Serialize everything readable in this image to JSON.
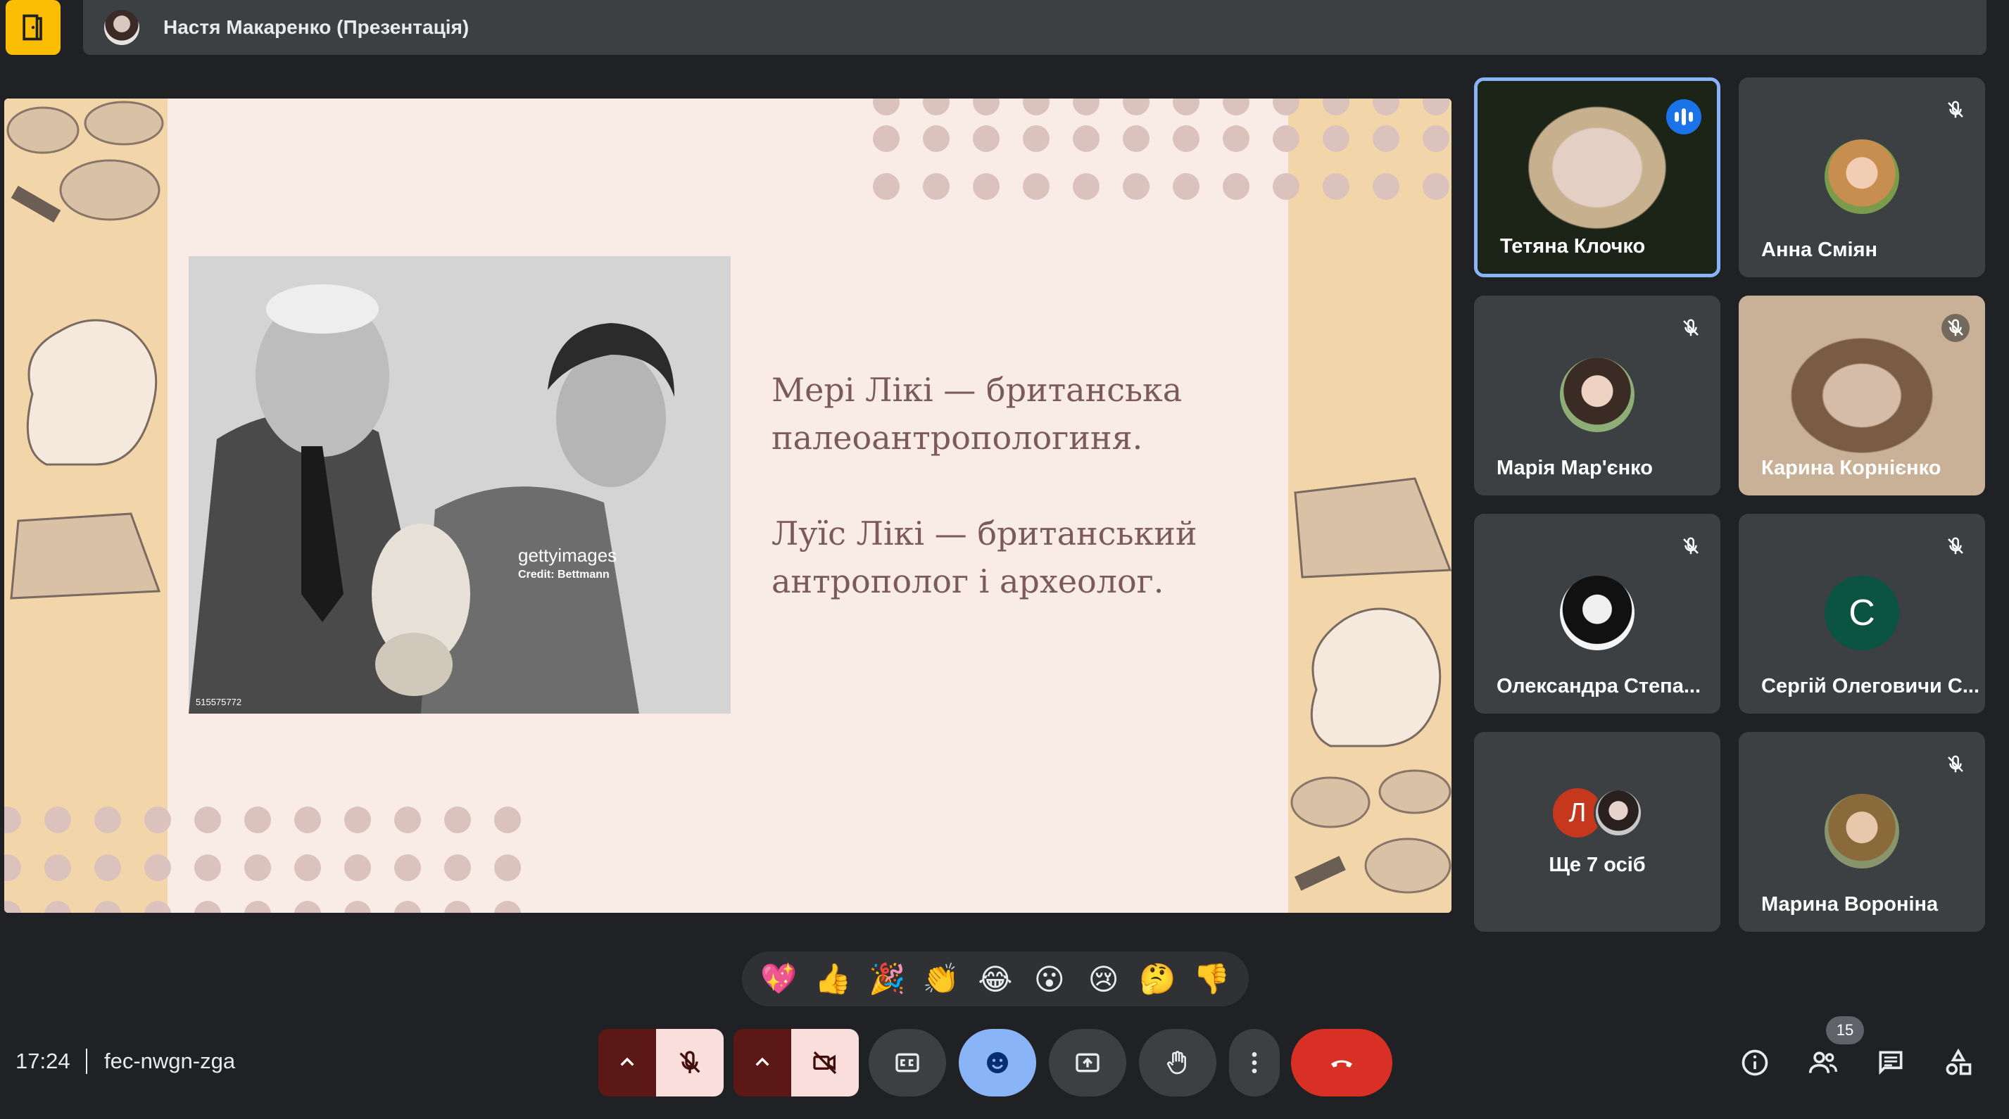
{
  "presenter": {
    "name": "Настя Макаренко (Презентація)"
  },
  "slide": {
    "photo_watermark": "gettyimages",
    "photo_credit": "Credit: Bettmann",
    "photo_id": "515575772",
    "paragraphs": [
      "Мері Лікі — британська палеоантропологиня.",
      "Луїс Лікі — британський антрополог і археолог."
    ]
  },
  "participants": [
    {
      "name": "Тетяна Клочко",
      "speaking": true
    },
    {
      "name": "Анна Сміян",
      "muted": true
    },
    {
      "name": "Марія Мар'єнко",
      "muted": true
    },
    {
      "name": "Карина Корнієнко",
      "muted": true
    },
    {
      "name": "Олександра Степа...",
      "muted": true
    },
    {
      "name": "Сергій Олеговичи С...",
      "muted": true,
      "initial": "С"
    },
    {
      "name": "Ще 7 осіб",
      "initial": "Л"
    },
    {
      "name": "Марина Вороніна",
      "muted": true
    }
  ],
  "reactions": [
    "💖",
    "👍",
    "🎉",
    "👏",
    "😂",
    "😮",
    "😢",
    "🤔",
    "👎"
  ],
  "bottom": {
    "time": "17:24",
    "meeting_code": "fec-nwgn-zga",
    "people_count": "15"
  },
  "colors": {
    "background": "#202124",
    "tile": "#3c4043",
    "accent_blue": "#8ab4f8",
    "end_call": "#d93025",
    "slide_bg": "#f9ebe6",
    "slide_band": "#f2d6a9",
    "logo": "#fbbc04"
  }
}
